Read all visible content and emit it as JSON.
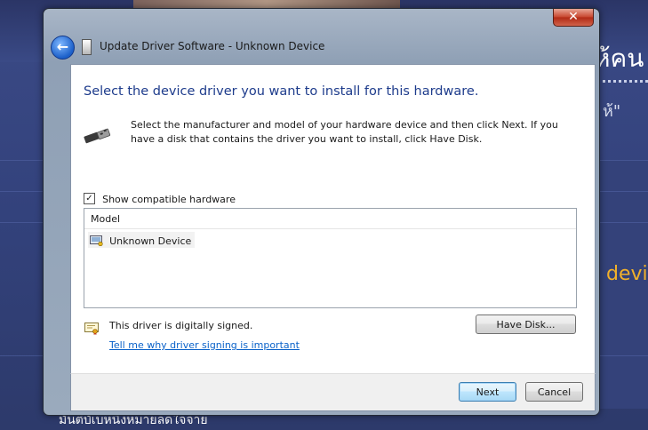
{
  "window": {
    "title": "Update Driver Software - Unknown Device",
    "close_glyph": "✕"
  },
  "main": {
    "heading": "Select the device driver you want to install for this hardware.",
    "description": "Select the manufacturer and model of your hardware device and then click Next. If you have a disk that contains the driver you want to install, click Have Disk.",
    "show_compatible": {
      "label": "Show compatible hardware",
      "checked": true,
      "glyph": "✓"
    },
    "list": {
      "column": "Model",
      "items": [
        {
          "label": "Unknown Device",
          "icon": "device-icon"
        }
      ]
    },
    "signed_text": "This driver is digitally signed.",
    "signing_link": "Tell me why driver signing is important",
    "have_disk_label": "Have Disk..."
  },
  "footer": {
    "next_label": "Next",
    "cancel_label": "Cancel"
  },
  "background": {
    "thai_title": "ห้คน",
    "quote": "ห้\"",
    "dev_text": "devi",
    "footer_text": "มันตีบัเบหนึ่งหมายลดใจจ่าย"
  },
  "colors": {
    "heading": "#1e3c8c",
    "link": "#0a62c9",
    "accent_bg": "#f2b12a"
  },
  "icons": [
    "back-arrow-icon",
    "window-icon",
    "usb-icon",
    "device-icon",
    "certificate-icon",
    "close-icon"
  ]
}
